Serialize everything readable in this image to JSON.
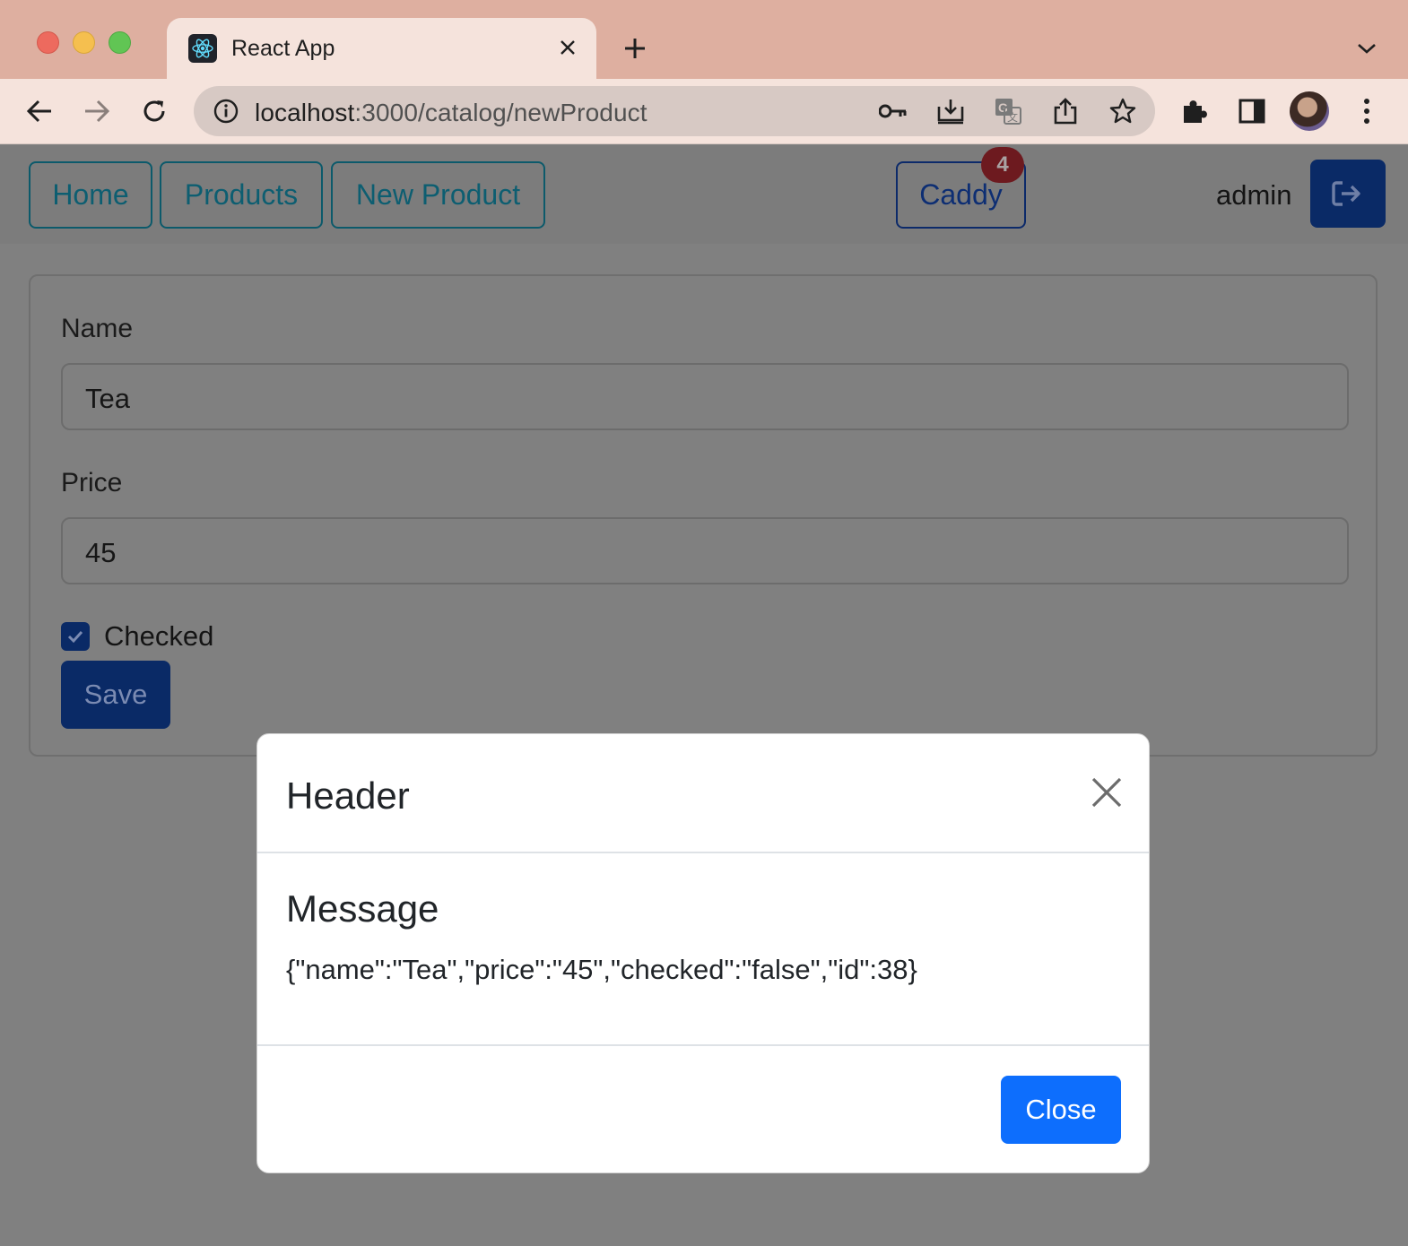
{
  "browser": {
    "tab_title": "React App",
    "url_host": "localhost",
    "url_path": ":3000/catalog/newProduct"
  },
  "nav": {
    "home_label": "Home",
    "products_label": "Products",
    "new_product_label": "New Product",
    "caddy_label": "Caddy",
    "caddy_count": "4",
    "username": "admin"
  },
  "form": {
    "name_label": "Name",
    "name_value": "Tea",
    "price_label": "Price",
    "price_value": "45",
    "checked_label": "Checked",
    "checked": true,
    "save_label": "Save"
  },
  "modal": {
    "title": "Header",
    "message_title": "Message",
    "message_text": "{\"name\":\"Tea\",\"price\":\"45\",\"checked\":\"false\",\"id\":38}",
    "close_label": "Close"
  },
  "colors": {
    "primary": "#0d6efd",
    "overlay": "#808080",
    "badge": "#dc3545"
  }
}
